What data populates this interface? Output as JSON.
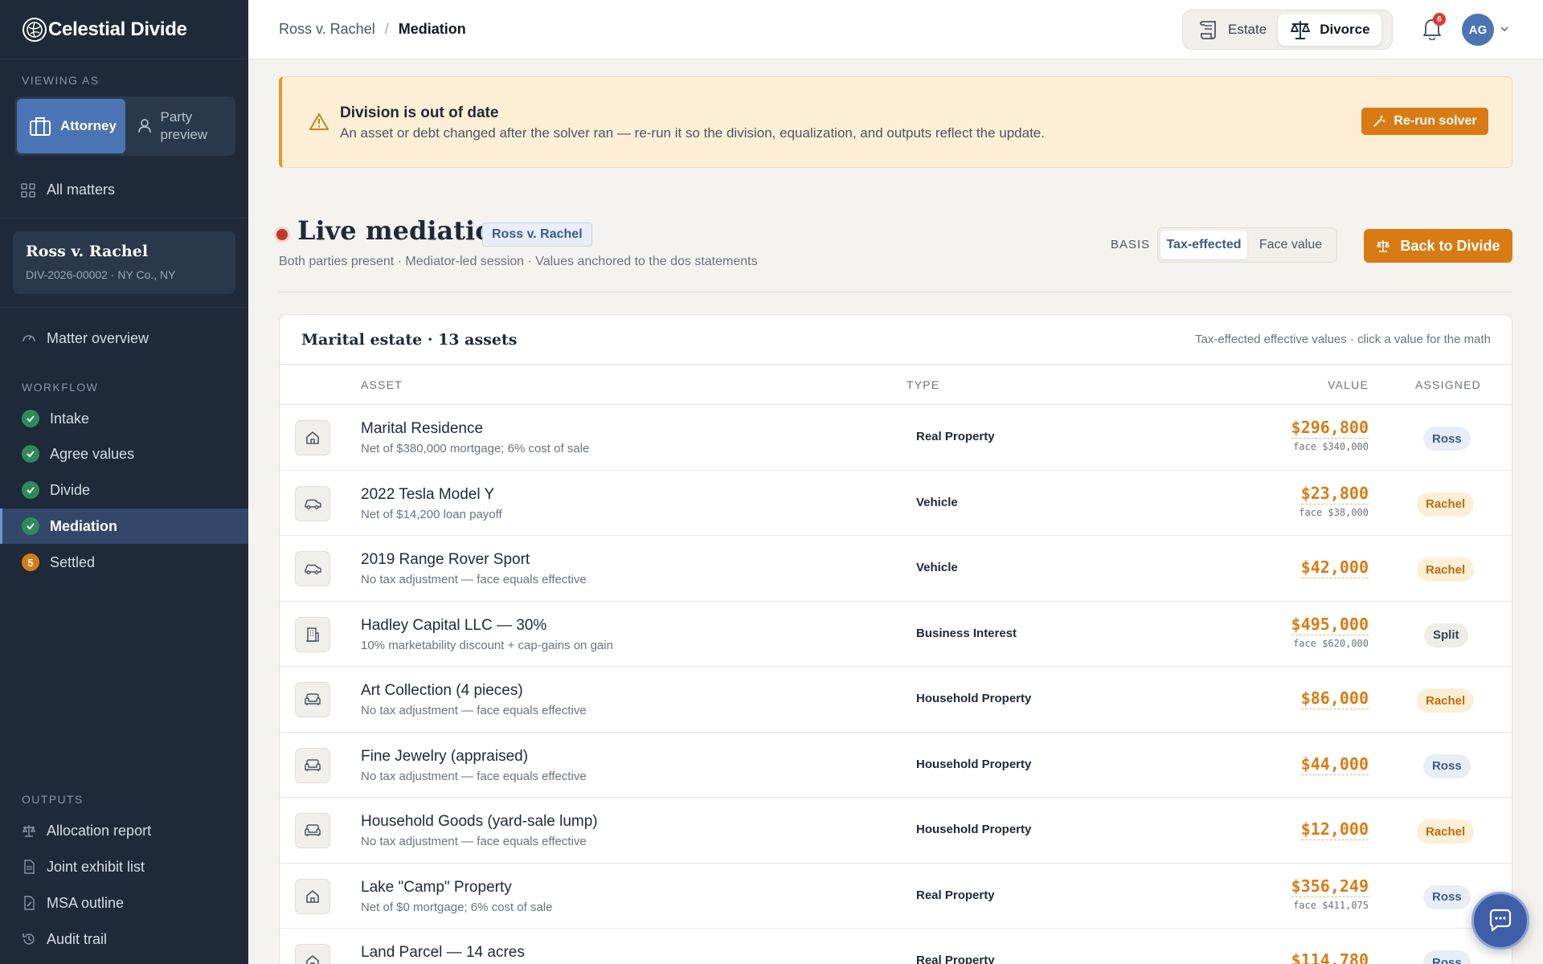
{
  "brand": {
    "name": "Celestial Divide"
  },
  "sidebar": {
    "viewing_as_label": "VIEWING AS",
    "roles": [
      {
        "label": "Attorney",
        "active": true
      },
      {
        "label": "Party preview",
        "active": false
      }
    ],
    "all_matters": "All matters",
    "matter": {
      "title": "Ross v. Rachel",
      "subtitle": "DIV-2026-00002 · NY Co., NY"
    },
    "matter_overview": "Matter overview",
    "workflow_label": "WORKFLOW",
    "workflow": [
      {
        "label": "Intake",
        "status": "done"
      },
      {
        "label": "Agree values",
        "status": "done"
      },
      {
        "label": "Divide",
        "status": "done"
      },
      {
        "label": "Mediation",
        "status": "done",
        "active": true
      },
      {
        "label": "Settled",
        "status": "pending",
        "step": "5"
      }
    ],
    "outputs_label": "OUTPUTS",
    "outputs": [
      {
        "label": "Allocation report",
        "icon": "scale-icon"
      },
      {
        "label": "Joint exhibit list",
        "icon": "document-icon"
      },
      {
        "label": "MSA outline",
        "icon": "edit-document-icon"
      },
      {
        "label": "Audit trail",
        "icon": "history-icon"
      }
    ]
  },
  "topbar": {
    "breadcrumb": {
      "parent": "Ross v. Rachel",
      "separator": "/",
      "current": "Mediation"
    },
    "modes": [
      {
        "label": "Estate",
        "active": false
      },
      {
        "label": "Divorce",
        "active": true
      }
    ],
    "notifications_count": "6",
    "avatar_initials": "AG"
  },
  "alert": {
    "title": "Division is out of date",
    "body": "An asset or debt changed after the solver ran — re-run it so the division, equalization, and outputs reflect the update.",
    "action": "Re-run solver"
  },
  "header": {
    "title": "Live mediation",
    "case_chip": "Ross v. Rachel",
    "subtitle": "Both parties present · Mediator-led session · Values anchored to the dos statements",
    "basis_label": "BASIS",
    "basis_options": [
      {
        "label": "Tax-effected",
        "active": true
      },
      {
        "label": "Face value",
        "active": false
      }
    ],
    "back_button": "Back to Divide"
  },
  "table": {
    "title": "Marital estate · 13 assets",
    "hint": "Tax-effected effective values · click a value for the math",
    "columns": {
      "asset": "ASSET",
      "type": "TYPE",
      "value": "VALUE",
      "assigned": "ASSIGNED"
    },
    "rows": [
      {
        "icon": "house-icon",
        "name": "Marital Residence",
        "note": "Net of $380,000 mortgage; 6% cost of sale",
        "type": "Real Property",
        "value": "$296,800",
        "face": "face $340,000",
        "assigned": "Ross"
      },
      {
        "icon": "car-icon",
        "name": "2022 Tesla Model Y",
        "note": "Net of $14,200 loan payoff",
        "type": "Vehicle",
        "value": "$23,800",
        "face": "face $38,000",
        "assigned": "Rachel"
      },
      {
        "icon": "car-icon",
        "name": "2019 Range Rover Sport",
        "note": "No tax adjustment — face equals effective",
        "type": "Vehicle",
        "value": "$42,000",
        "face": "",
        "assigned": "Rachel"
      },
      {
        "icon": "building-icon",
        "name": "Hadley Capital LLC — 30%",
        "note": "10% marketability discount + cap-gains on gain",
        "type": "Business Interest",
        "value": "$495,000",
        "face": "face $620,000",
        "assigned": "Split"
      },
      {
        "icon": "sofa-icon",
        "name": "Art Collection (4 pieces)",
        "note": "No tax adjustment — face equals effective",
        "type": "Household Property",
        "value": "$86,000",
        "face": "",
        "assigned": "Rachel"
      },
      {
        "icon": "sofa-icon",
        "name": "Fine Jewelry (appraised)",
        "note": "No tax adjustment — face equals effective",
        "type": "Household Property",
        "value": "$44,000",
        "face": "",
        "assigned": "Ross"
      },
      {
        "icon": "sofa-icon",
        "name": "Household Goods (yard-sale lump)",
        "note": "No tax adjustment — face equals effective",
        "type": "Household Property",
        "value": "$12,000",
        "face": "",
        "assigned": "Rachel"
      },
      {
        "icon": "house-icon",
        "name": "Lake \"Camp\" Property",
        "note": "Net of $0 mortgage; 6% cost of sale",
        "type": "Real Property",
        "value": "$356,249",
        "face": "face $411,075",
        "assigned": "Ross"
      },
      {
        "icon": "house-icon",
        "name": "Land Parcel — 14 acres",
        "note": "",
        "type": "Real Property",
        "value": "$114,780",
        "face": "",
        "assigned": "Ross"
      }
    ]
  }
}
